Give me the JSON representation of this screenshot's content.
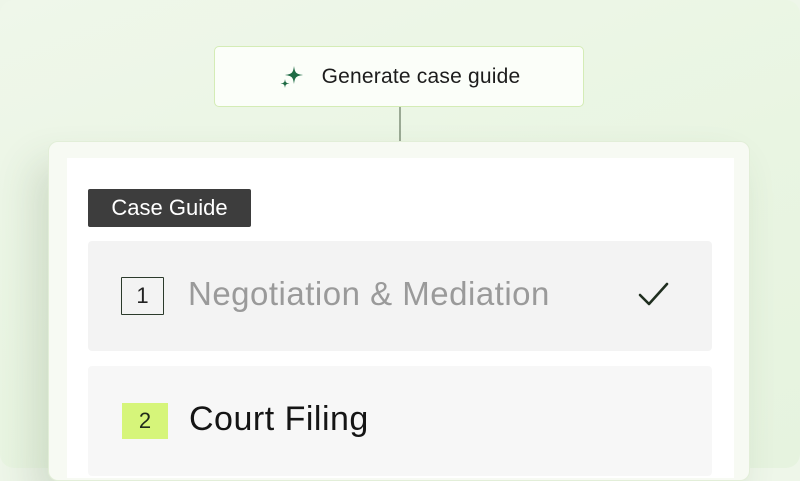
{
  "generate_button": {
    "label": "Generate case guide",
    "icon": "sparkle-icon",
    "icon_color": "#1f6b45"
  },
  "case_guide": {
    "tag_label": "Case Guide",
    "steps": [
      {
        "number": "1",
        "title": "Negotiation & Mediation",
        "status": "completed",
        "status_icon": "checkmark-icon"
      },
      {
        "number": "2",
        "title": "Court Filing",
        "status": "active"
      }
    ]
  },
  "colors": {
    "background": "#eef6e9",
    "accent_lime": "#d6f57a",
    "tag_bg": "#3d3d3d",
    "check_color": "#1f2e1f"
  }
}
